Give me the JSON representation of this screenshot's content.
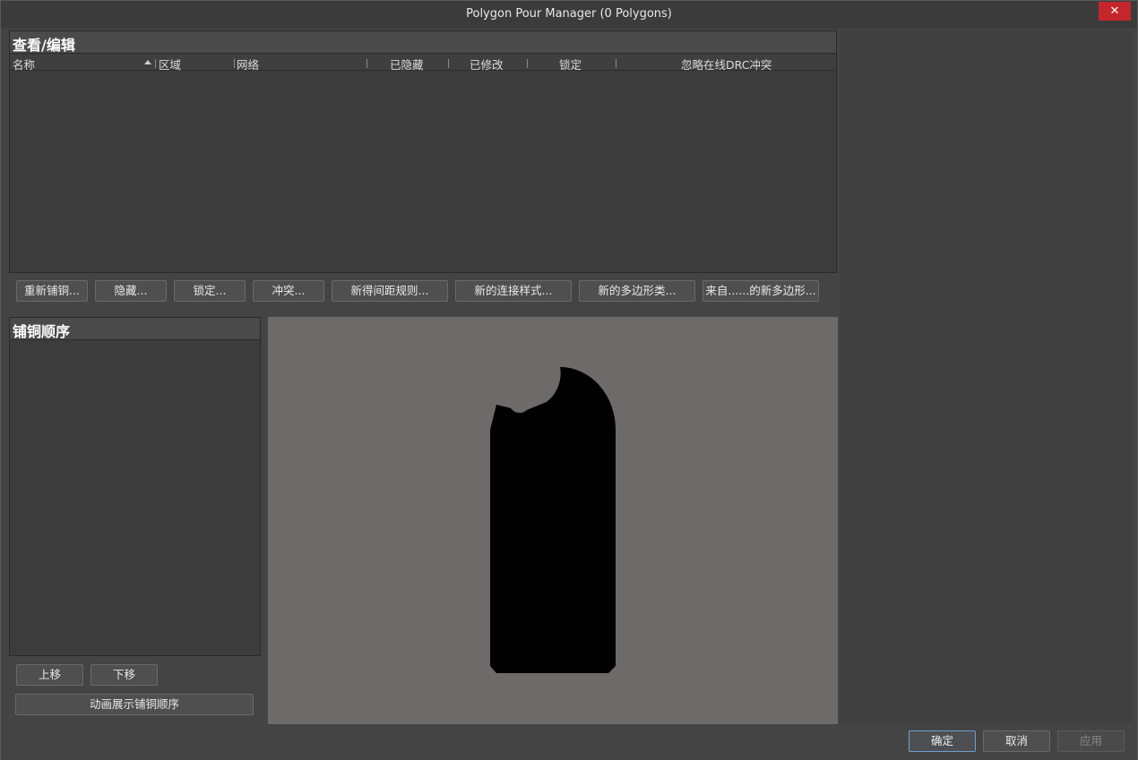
{
  "window": {
    "title": "Polygon Pour Manager (0 Polygons)",
    "close_glyph": "✕"
  },
  "view_edit": {
    "title": "查看/编辑",
    "columns": [
      "名称",
      "区域",
      "网络",
      "已隐藏",
      "已修改",
      "锁定",
      "忽略在线DRC冲突"
    ]
  },
  "actions": [
    "重新铺铜...",
    "隐藏...",
    "锁定...",
    "冲突...",
    "新得间距规则...",
    "新的连接样式...",
    "新的多边形类...",
    "来自......的新多边形..."
  ],
  "pour_order": {
    "title": "铺铜顺序",
    "move_up": "上移",
    "move_down": "下移",
    "animate": "动画展示铺铜顺序"
  },
  "preview": {
    "background_color": "#6d6a69",
    "shape_color": "#000000"
  },
  "footer": {
    "ok": "确定",
    "cancel": "取消",
    "apply": "应用"
  }
}
